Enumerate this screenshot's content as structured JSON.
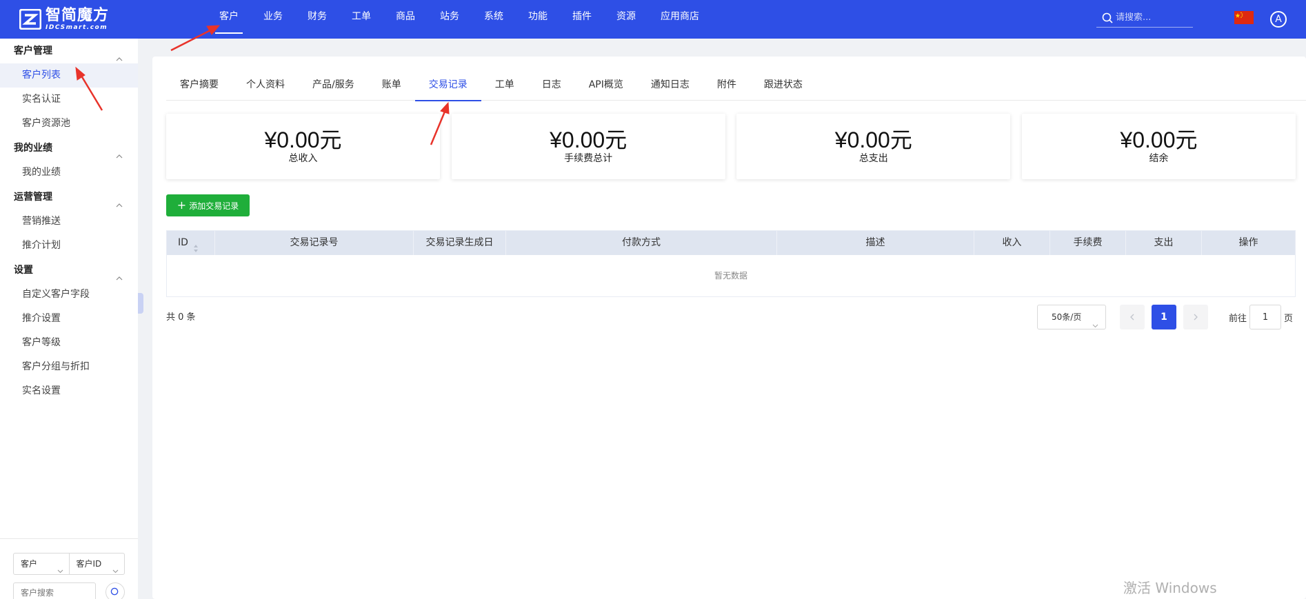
{
  "brand": {
    "name_cn": "智简魔方",
    "name_en": "IDCSmart.com"
  },
  "nav": {
    "items": [
      "客户",
      "业务",
      "财务",
      "工单",
      "商品",
      "站务",
      "系统",
      "功能",
      "插件",
      "资源",
      "应用商店"
    ],
    "active_index": 0
  },
  "search": {
    "placeholder": "请搜索..."
  },
  "user": {
    "avatar_letter": "A"
  },
  "sidebar": {
    "groups": [
      {
        "title": "客户管理",
        "items": [
          "客户列表",
          "实名认证",
          "客户资源池"
        ]
      },
      {
        "title": "我的业绩",
        "items": [
          "我的业绩"
        ]
      },
      {
        "title": "运营管理",
        "items": [
          "营销推送",
          "推介计划"
        ]
      },
      {
        "title": "设置",
        "items": [
          "自定义客户字段",
          "推介设置",
          "客户等级",
          "客户分组与折扣",
          "实名设置"
        ]
      }
    ],
    "active_item": "客户列表",
    "bottom": {
      "select1": "客户",
      "select2": "客户ID",
      "keyword_placeholder": "客户搜索"
    }
  },
  "tabs": {
    "items": [
      "客户摘要",
      "个人资料",
      "产品/服务",
      "账单",
      "交易记录",
      "工单",
      "日志",
      "API概览",
      "通知日志",
      "附件",
      "跟进状态"
    ],
    "active_index": 4
  },
  "stats": [
    {
      "value": "¥0.00元",
      "label": "总收入"
    },
    {
      "value": "¥0.00元",
      "label": "手续费总计"
    },
    {
      "value": "¥0.00元",
      "label": "总支出"
    },
    {
      "value": "¥0.00元",
      "label": "结余"
    }
  ],
  "add_button": "添加交易记录",
  "table": {
    "columns": [
      "ID",
      "交易记录号",
      "交易记录生成日",
      "付款方式",
      "描述",
      "收入",
      "手续费",
      "支出",
      "操作"
    ],
    "empty_text": "暂无数据"
  },
  "pagination": {
    "total_text": "共 0 条",
    "page_size": "50条/页",
    "current_page": "1",
    "goto_prefix": "前往",
    "goto_value": "1",
    "goto_suffix": "页"
  },
  "watermark": "激活 Windows",
  "colors": {
    "primary": "#2e4fe6",
    "success": "#1fae3a",
    "annotation": "#e8332a"
  }
}
